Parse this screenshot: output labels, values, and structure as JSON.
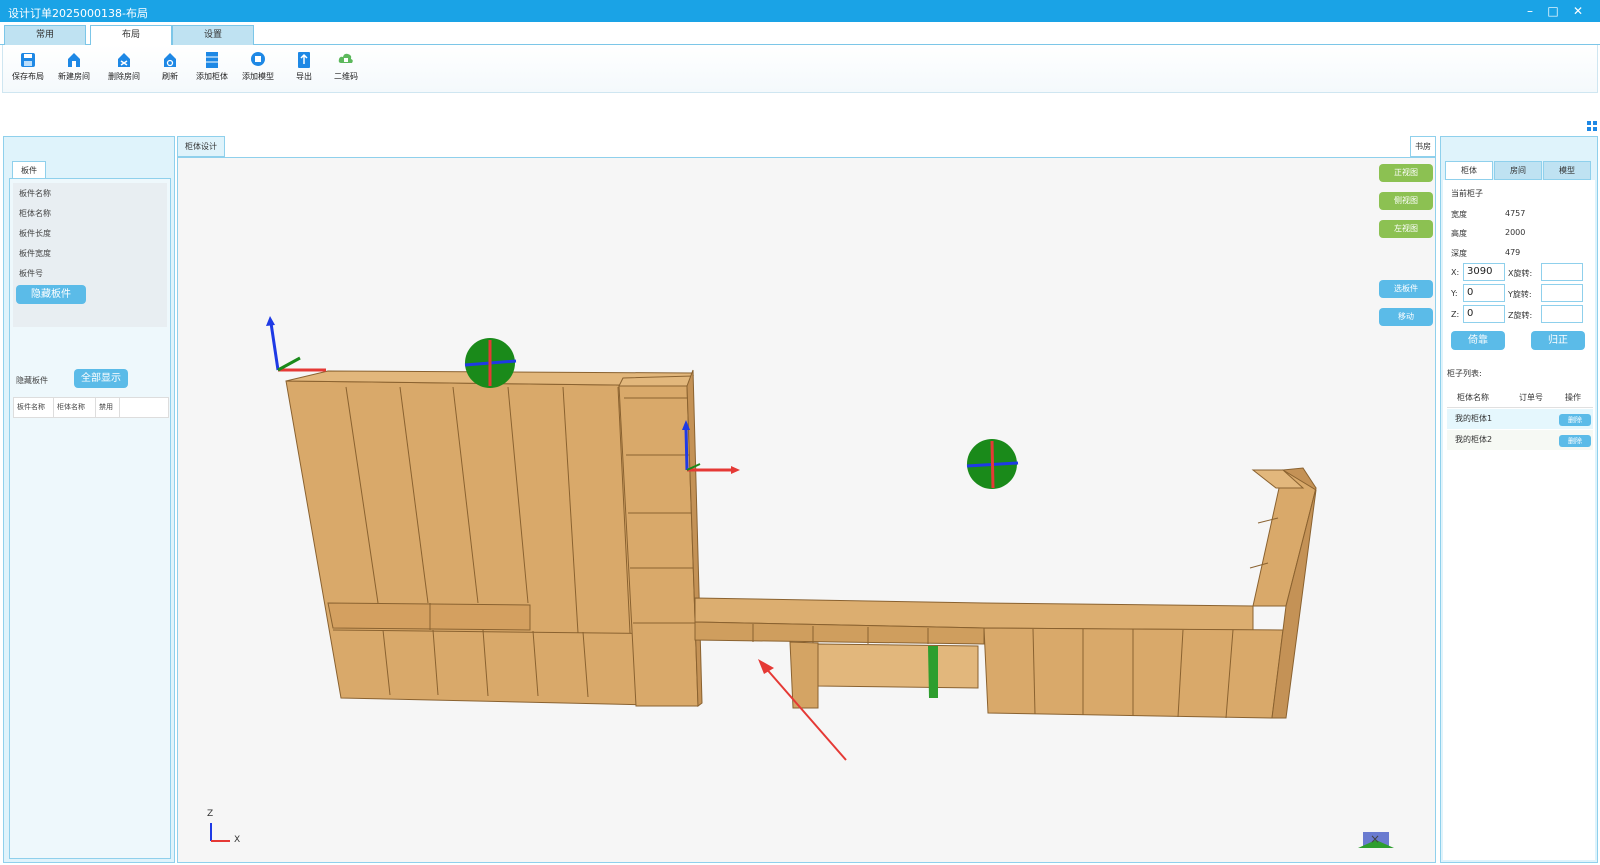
{
  "window": {
    "title": "设计订单2025000138-布局",
    "minimize_icon": "minimize-icon",
    "maximize_icon": "maximize-icon",
    "close_icon": "close-icon"
  },
  "ribbon": {
    "tabs": [
      {
        "label": "常用",
        "active": false
      },
      {
        "label": "布局",
        "active": true
      },
      {
        "label": "设置",
        "active": false
      }
    ],
    "tools": [
      {
        "label": "保存布局",
        "icon": "save-icon",
        "color": "#1e88e5"
      },
      {
        "label": "新建房间",
        "icon": "new-room-icon",
        "color": "#1e88e5"
      },
      {
        "label": "删除房间",
        "icon": "delete-room-icon",
        "color": "#1e88e5"
      },
      {
        "label": "刷新",
        "icon": "refresh-icon",
        "color": "#1e88e5"
      },
      {
        "label": "添加柜体",
        "icon": "add-cabinet-icon",
        "color": "#1e88e5"
      },
      {
        "label": "添加模型",
        "icon": "add-model-icon",
        "color": "#1e88e5"
      },
      {
        "label": "导出",
        "icon": "export-icon",
        "color": "#1e88e5"
      },
      {
        "label": "二维码",
        "icon": "qrcode-cloud-icon",
        "color": "#5cb85c"
      }
    ]
  },
  "left_panel": {
    "tab": "板件",
    "props": [
      "板件名称",
      "柜体名称",
      "板件长度",
      "板件宽度",
      "板件号"
    ],
    "hide_button": "隐藏板件",
    "hidden_label": "隐藏板件",
    "show_all_button": "全部显示",
    "table_headers": [
      "板件名称",
      "柜体名称",
      "禁用"
    ]
  },
  "viewport": {
    "tab": "柜体设计",
    "room_tab": "书房",
    "view_buttons": [
      "正视图",
      "侧视图",
      "左视图"
    ],
    "action_buttons": [
      "选板件",
      "移动"
    ],
    "axis_z": "Z",
    "axis_x": "X",
    "close_icon": "close-icon",
    "colors": {
      "wood": "#d9a96a",
      "wood_dark": "#b9864a",
      "gizmo_green": "#1a8a1a",
      "axis_red": "#e53935",
      "axis_blue": "#1e3ae5",
      "arrow": "#e53935"
    }
  },
  "right_panel": {
    "tabs": [
      {
        "label": "柜体",
        "active": true
      },
      {
        "label": "房间",
        "active": false
      },
      {
        "label": "模型",
        "active": false
      }
    ],
    "current_label": "当前柜子",
    "width_label": "宽度",
    "width_value": "4757",
    "height_label": "高度",
    "height_value": "2000",
    "depth_label": "深度",
    "depth_value": "479",
    "x_label": "X:",
    "x_value": "3090",
    "y_label": "Y:",
    "y_value": "0",
    "z_label": "Z:",
    "z_value": "0",
    "xrot_label": "X旋转:",
    "yrot_label": "Y旋转:",
    "zrot_label": "Z旋转:",
    "xrot_value": "",
    "yrot_value": "",
    "zrot_value": "",
    "align_button": "倚靠",
    "reset_button": "归正",
    "list_title": "柜子列表:",
    "list_headers": [
      "柜体名称",
      "订单号",
      "操作"
    ],
    "rows": [
      {
        "name": "我的柜体1",
        "order": "",
        "action": "删除"
      },
      {
        "name": "我的柜体2",
        "order": "",
        "action": "删除"
      }
    ]
  }
}
